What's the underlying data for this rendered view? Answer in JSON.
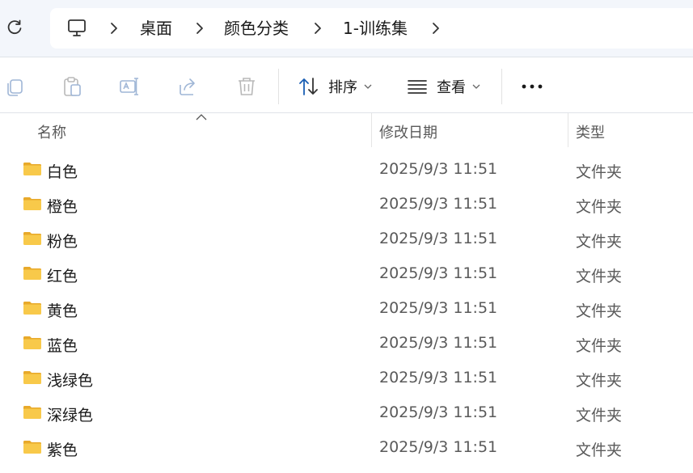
{
  "address_bar": {
    "breadcrumbs": [
      "桌面",
      "颜色分类",
      "1-训练集"
    ]
  },
  "toolbar": {
    "sort_label": "排序",
    "view_label": "查看"
  },
  "columns": {
    "name": "名称",
    "modified": "修改日期",
    "type": "类型"
  },
  "files": [
    {
      "name": "白色",
      "modified": "2025/9/3 11:51",
      "type": "文件夹"
    },
    {
      "name": "橙色",
      "modified": "2025/9/3 11:51",
      "type": "文件夹"
    },
    {
      "name": "粉色",
      "modified": "2025/9/3 11:51",
      "type": "文件夹"
    },
    {
      "name": "红色",
      "modified": "2025/9/3 11:51",
      "type": "文件夹"
    },
    {
      "name": "黄色",
      "modified": "2025/9/3 11:51",
      "type": "文件夹"
    },
    {
      "name": "蓝色",
      "modified": "2025/9/3 11:51",
      "type": "文件夹"
    },
    {
      "name": "浅绿色",
      "modified": "2025/9/3 11:51",
      "type": "文件夹"
    },
    {
      "name": "深绿色",
      "modified": "2025/9/3 11:51",
      "type": "文件夹"
    },
    {
      "name": "紫色",
      "modified": "2025/9/3 11:51",
      "type": "文件夹"
    }
  ],
  "icons": {
    "refresh": "refresh-icon",
    "computer": "computer-icon",
    "copy": "copy-icon",
    "paste": "paste-icon",
    "rename": "rename-icon",
    "share": "share-icon",
    "delete": "delete-icon",
    "sort": "sort-icon",
    "view": "view-icon",
    "more": "more-icon",
    "folder": "folder-icon"
  },
  "colors": {
    "folder_yellow": "#f8c94a",
    "topbar_bg": "#f3f6fb",
    "sort_blue": "#1a5fb4"
  }
}
